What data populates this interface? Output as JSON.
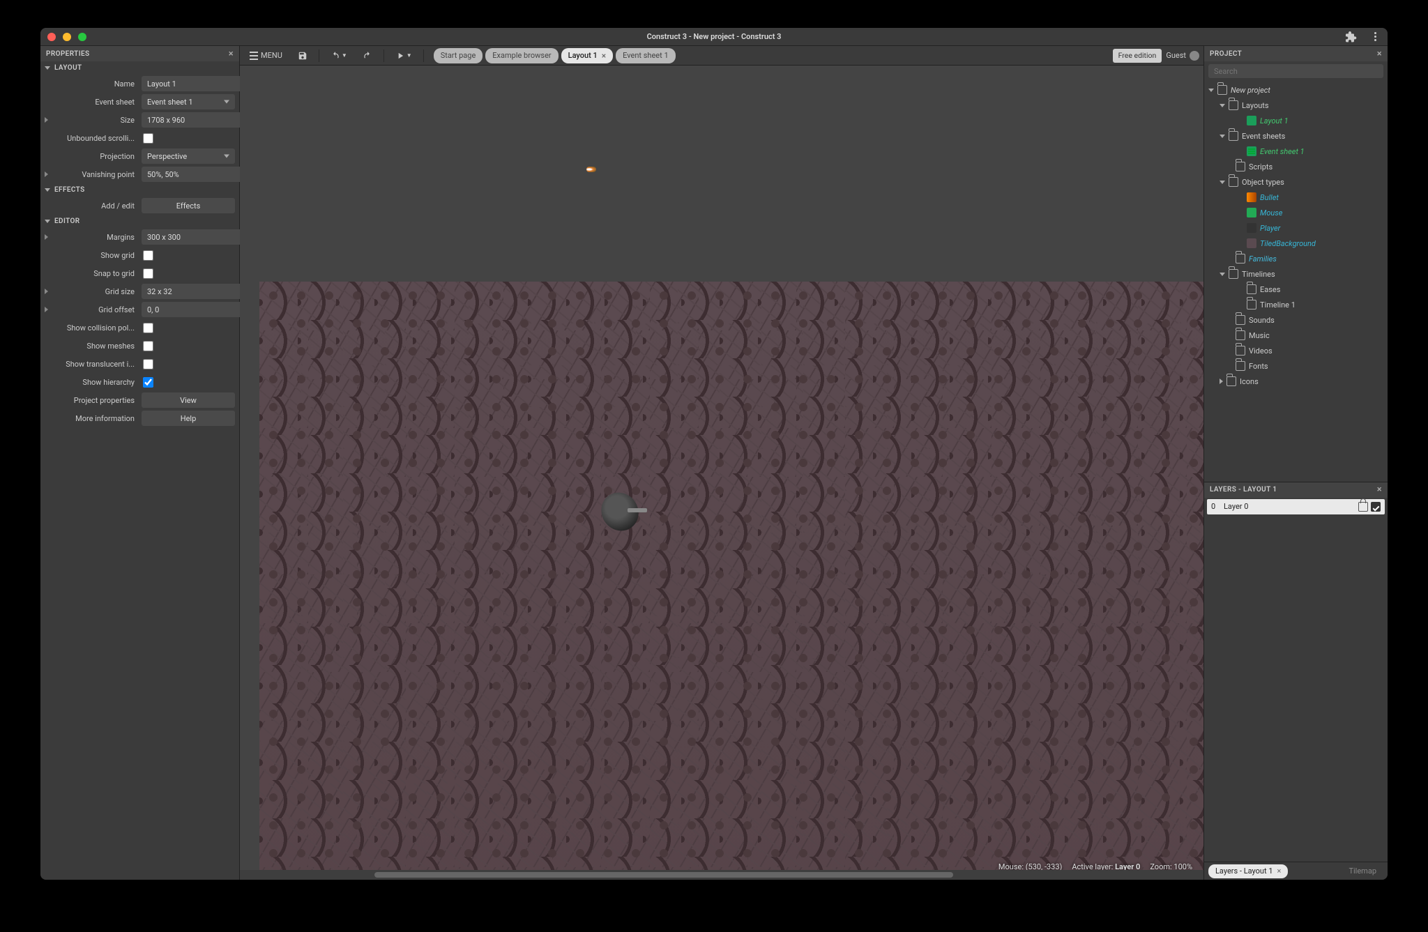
{
  "titlebar": {
    "title": "Construct 3 - New project - Construct 3"
  },
  "toolbar": {
    "menu_label": "MENU",
    "free_edition": "Free edition",
    "guest": "Guest"
  },
  "tabs": {
    "start": "Start page",
    "example": "Example browser",
    "layout": "Layout 1",
    "sheet": "Event sheet 1"
  },
  "properties_panel": {
    "title": "PROPERTIES",
    "groups": {
      "layout": "LAYOUT",
      "effects": "EFFECTS",
      "editor": "EDITOR"
    },
    "rows": {
      "name_label": "Name",
      "name_value": "Layout 1",
      "eventsheet_label": "Event sheet",
      "eventsheet_value": "Event sheet 1",
      "size_label": "Size",
      "size_value": "1708 x 960",
      "unbounded_label": "Unbounded scrolli...",
      "projection_label": "Projection",
      "projection_value": "Perspective",
      "vanishing_label": "Vanishing point",
      "vanishing_value": "50%, 50%",
      "addedit_label": "Add / edit",
      "effects_btn": "Effects",
      "margins_label": "Margins",
      "margins_value": "300 x 300",
      "showgrid_label": "Show grid",
      "snapgrid_label": "Snap to grid",
      "gridsize_label": "Grid size",
      "gridsize_value": "32 x 32",
      "gridoffset_label": "Grid offset",
      "gridoffset_value": "0, 0",
      "showcoll_label": "Show collision pol...",
      "showmesh_label": "Show meshes",
      "showtrans_label": "Show translucent i...",
      "showhier_label": "Show hierarchy",
      "projprops_label": "Project properties",
      "view_btn": "View",
      "moreinfo_label": "More information",
      "help_btn": "Help"
    }
  },
  "project_panel": {
    "title": "PROJECT",
    "search_placeholder": "Search",
    "tree": {
      "project": "New project",
      "layouts": "Layouts",
      "layout1": "Layout 1",
      "eventsheets": "Event sheets",
      "es1": "Event sheet 1",
      "scripts": "Scripts",
      "objecttypes": "Object types",
      "bullet": "Bullet",
      "mouse": "Mouse",
      "player": "Player",
      "tiledbg": "TiledBackground",
      "families": "Families",
      "timelines": "Timelines",
      "eases": "Eases",
      "timeline1": "Timeline 1",
      "sounds": "Sounds",
      "music": "Music",
      "videos": "Videos",
      "fonts": "Fonts",
      "icons": "Icons"
    }
  },
  "layers_panel": {
    "title": "LAYERS - LAYOUT 1",
    "layer0_idx": "0",
    "layer0_name": "Layer 0",
    "tab_layers": "Layers - Layout 1",
    "tab_tilemap": "Tilemap"
  },
  "status": {
    "mouse": "Mouse: (530, -333)",
    "active_layer_pre": "Active layer: ",
    "active_layer_name": "Layer 0",
    "zoom": "Zoom: 100%"
  }
}
